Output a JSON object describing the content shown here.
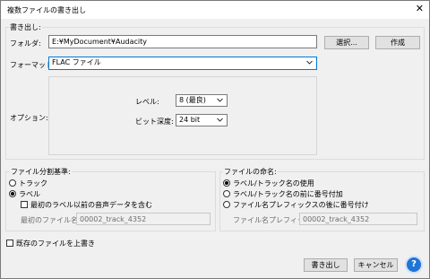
{
  "window": {
    "title": "複数ファイルの書き出し",
    "close_glyph": "✕"
  },
  "export": {
    "legend": "書き出し:",
    "folder_label": "フォルダ:",
    "folder_value": "E:¥MyDocument¥Audacity",
    "browse_button": "選択...",
    "create_button": "作成",
    "format_label": "フォーマット:",
    "format_value": "FLAC ファイル",
    "options_label": "オプション:",
    "level_label": "レベル:",
    "level_value": "8 (最良)",
    "bitdepth_label": "ビット深度:",
    "bitdepth_value": "24 bit"
  },
  "split": {
    "legend": "ファイル分割基準:",
    "options": [
      "トラック",
      "ラベル"
    ],
    "selected": "ラベル",
    "include_audio_label": "最初のラベル以前の音声データを含む",
    "first_file_label": "最初のファイル名:",
    "first_file_value": "00002_track_4352"
  },
  "naming": {
    "legend": "ファイルの命名:",
    "options": [
      "ラベル/トラック名の使用",
      "ラベル/トラック名の前に番号付加",
      "ファイル名プレフィックスの後に番号付け"
    ],
    "selected": "ラベル/トラック名の使用",
    "prefix_label": "ファイル名プレフィックス:",
    "prefix_value": "00002_track_4352"
  },
  "overwrite_label": "既存のファイルを上書き",
  "buttons": {
    "export": "書き出し",
    "cancel": "キャンセル",
    "help": "?"
  },
  "colors": {
    "focus": "#0078d7",
    "help": "#1f74d6"
  }
}
